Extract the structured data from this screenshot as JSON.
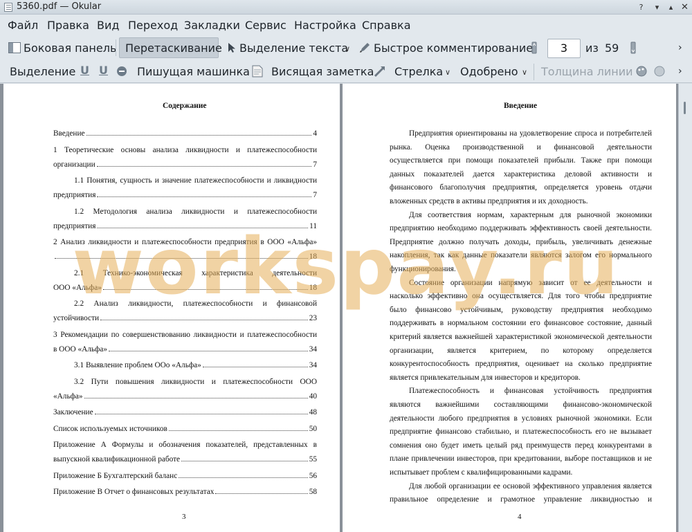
{
  "window": {
    "title": "5360.pdf  — Okular"
  },
  "menubar": [
    "Файл",
    "Правка",
    "Вид",
    "Переход",
    "Закладки",
    "Сервис",
    "Настройка",
    "Справка"
  ],
  "toolbar1": {
    "sidebar": "Боковая панель",
    "drag": "Перетаскивание",
    "select_text": "Выделение текста",
    "quick_annot": "Быстрое комментирование",
    "page_current": "3",
    "page_of": "из",
    "page_total": "59"
  },
  "toolbar2": {
    "selection": "Выделение",
    "typewriter": "Пишущая машинка",
    "sticky_note": "Висящая заметка",
    "arrow": "Стрелка",
    "approved": "Одобрено",
    "line_width": "Толщина линии"
  },
  "left_page": {
    "heading": "Содержание",
    "toc": [
      {
        "t": "Введение",
        "n": "4"
      },
      {
        "l1": "1  Теоретические  основы  анализа  ликвидности  и  платежеспособности",
        "t": "организации",
        "n": "7"
      },
      {
        "l1": "1.1 Понятия, сущность и значение платежеспособности и ликвидности",
        "t": "предприятия",
        "n": "7"
      },
      {
        "l1": "1.2   Методология   анализа   ликвидности   и   платежеспособности",
        "t": "предприятия",
        "n": "11"
      },
      {
        "l1": "2 Анализ ликвидности и платежеспособности предприятия в ООО «Альфа»",
        "t": "",
        "n": "18"
      },
      {
        "l1": "2.1      Технико-экономическая      характеристика      деятельности",
        "t": "ООО «Альфа»",
        "n": "18"
      },
      {
        "l1": "2.2  Анализ   ликвидности,   платежеспособности   и   финансовой",
        "t": "устойчивости",
        "n": "23"
      },
      {
        "l1": "3 Рекомендации по совершенствованию ликвидности и платежеспособности",
        "t": "в ООО «Альфа»",
        "n": "34"
      },
      {
        "t": "3.1 Выявление проблем ООо «Альфа»",
        "n": "34"
      },
      {
        "l1": "3.2  Пути   повышения   ликвидности   и   платежеспособности   ООО",
        "t": "«Альфа»",
        "n": "40"
      },
      {
        "t": "Заключение",
        "n": "48"
      },
      {
        "t": "Список используемых источников",
        "n": "50"
      },
      {
        "l1": "Приложение  А  Формулы  и  обозначения  показателей,  представленных  в",
        "t": "выпускной квалификационной работе",
        "n": "55"
      },
      {
        "t": "Приложение Б Бухгалтерский баланс",
        "n": "56"
      },
      {
        "t": "Приложение В Отчет о финансовых результатах",
        "n": "58"
      }
    ],
    "page_number": "3"
  },
  "right_page": {
    "heading": "Введение",
    "lines": [
      "Предприятия ориентированы на удовлетворение спроса и потребителей",
      "рынка.   Оценка   производственной   и   финансовой   деятельности",
      "осуществляется при помощи показателей прибыли. Также при помощи",
      "данных  показателей  дается  характеристика  деловой  активности  и",
      "финансового  благополучия  предприятия,  определяется  уровень  отдачи",
      "вложенных средств в активы предприятия и их доходность.",
      "Для соответствия нормам, характерным для рыночной экономики",
      "предприятию необходимо поддерживать эффективность своей деятельности.",
      "Предприятие должно получать доходы, прибыль, увеличивать денежные",
      "накопления, так как данные показатели являются залогом его нормального",
      "функционирования.",
      "Состояние  организации  напрямую  зависит  от  ее  деятельности  и",
      "насколько эффективно она осуществляется. Для того чтобы предприятие",
      "было  финансово  устойчивым,  руководству  предприятия  необходимо",
      "поддерживать в нормальном состоянии его финансовое состояние, данный",
      "критерий является важнейшей характеристикой экономической деятельности",
      "организации,     является     критерием,     по     которому     определяется",
      "конкурентоспособность  предприятия,  оценивает  на  сколько  предприятие",
      "является привлекательным для инвесторов и кредиторов.",
      "Платежеспособность   и   финансовая   устойчивость   предприятия",
      "являются   важнейшими   составляющими   финансово-экономической",
      "деятельности любого предприятия в условиях рыночной экономики. Если",
      "предприятие финансово стабильно, и платежеспособность его не вызывает",
      "сомнения оно будет иметь целый ряд преимуществ перед конкурентами в",
      "плане привлечении инвесторов, при кредитовании, выборе поставщиков и не",
      "испытывает проблем с квалифицированными кадрами.",
      "Для любой организации ее основой эффективного управления является",
      "правильное   определение   и   грамотное   управление   ликвидностью   и"
    ],
    "page_number": "4"
  },
  "watermark": "workspay.ru"
}
